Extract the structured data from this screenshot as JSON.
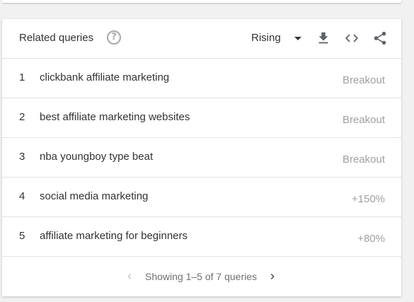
{
  "header": {
    "title": "Related queries",
    "help_icon": "help-circle-icon",
    "dropdown_value": "Rising",
    "tools": [
      "download-icon",
      "embed-code-icon",
      "share-icon"
    ]
  },
  "rows": [
    {
      "rank": "1",
      "query": "clickbank affiliate marketing",
      "value": "Breakout"
    },
    {
      "rank": "2",
      "query": "best affiliate marketing websites",
      "value": "Breakout"
    },
    {
      "rank": "3",
      "query": "nba youngboy type beat",
      "value": "Breakout"
    },
    {
      "rank": "4",
      "query": "social media marketing",
      "value": "+150%"
    },
    {
      "rank": "5",
      "query": "affiliate marketing for beginners",
      "value": "+80%"
    }
  ],
  "pager": {
    "text": "Showing 1–5 of 7 queries"
  },
  "colors": {
    "text": "#333333",
    "muted": "#a0a0a0",
    "icon": "#5f6368",
    "background": "#f1f1f1"
  }
}
